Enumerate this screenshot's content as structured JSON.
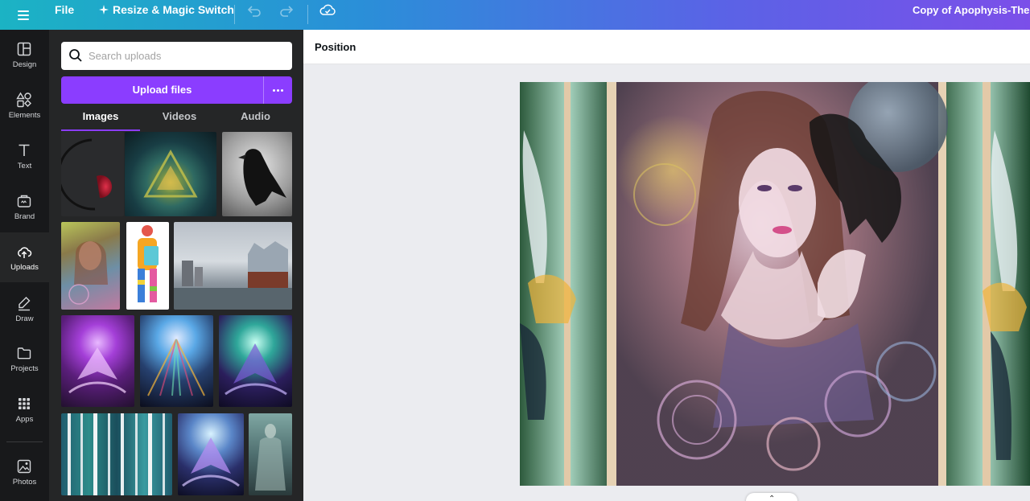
{
  "topbar": {
    "file_label": "File",
    "resize_label": "Resize & Magic Switch",
    "title": "Copy of Apophysis-ThePr"
  },
  "rail": {
    "items": [
      {
        "label": "Design",
        "icon": "layout-icon"
      },
      {
        "label": "Elements",
        "icon": "shapes-icon"
      },
      {
        "label": "Text",
        "icon": "text-icon"
      },
      {
        "label": "Brand",
        "icon": "brand-icon"
      },
      {
        "label": "Uploads",
        "icon": "cloud-upload-icon"
      },
      {
        "label": "Draw",
        "icon": "pen-icon"
      },
      {
        "label": "Projects",
        "icon": "folder-icon"
      },
      {
        "label": "Apps",
        "icon": "grid-icon"
      },
      {
        "label": "Photos",
        "icon": "image-icon"
      }
    ],
    "active": "Uploads"
  },
  "panel": {
    "search_placeholder": "Search uploads",
    "upload_label": "Upload files",
    "tabs": [
      "Images",
      "Videos",
      "Audio"
    ],
    "active_tab": "Images"
  },
  "editor": {
    "position_label": "Position"
  },
  "colors": {
    "accent": "#8b3dff",
    "rail_bg": "#18191b",
    "panel_bg": "#252627",
    "canvas_bg": "#ebecf0"
  }
}
